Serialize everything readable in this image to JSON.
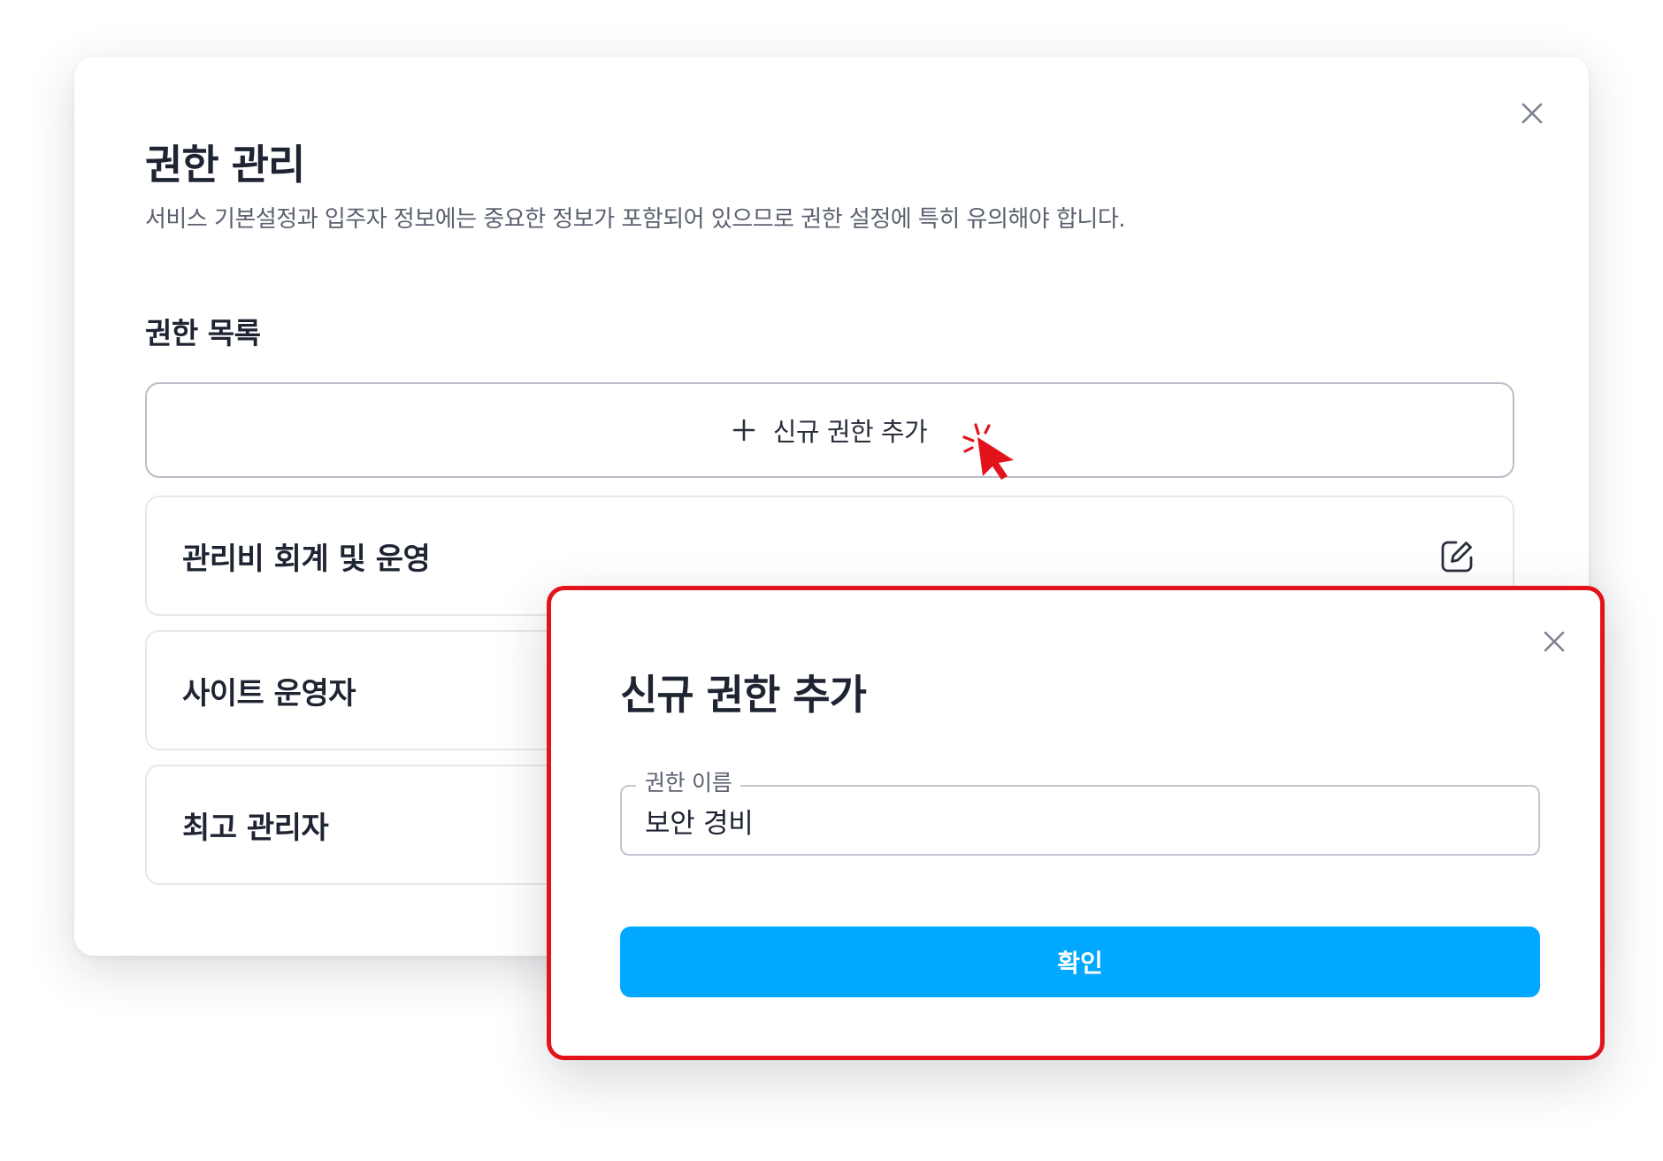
{
  "main_dialog": {
    "title": "권한 관리",
    "description": "서비스 기본설정과 입주자 정보에는 중요한 정보가 포함되어 있으므로 권한 설정에 특히 유의해야 합니다.",
    "close_icon": "close-icon",
    "section_title": "권한 목록",
    "add_button": {
      "icon": "plus-icon",
      "label": "신규 권한 추가"
    },
    "roles": [
      {
        "name": "관리비 회계 및 운영",
        "edit_icon": "edit-icon"
      },
      {
        "name": "사이트 운영자"
      },
      {
        "name": "최고 관리자"
      }
    ]
  },
  "modal": {
    "title": "신규 권한 추가",
    "close_icon": "close-icon",
    "field": {
      "label": "권한 이름",
      "value": "보안 경비"
    },
    "confirm_label": "확인"
  },
  "colors": {
    "accent": "#00a8ff",
    "highlight_border": "#e3131b",
    "cursor": "#e3131b",
    "text_primary": "#1f2433",
    "text_secondary": "#5b6170"
  }
}
